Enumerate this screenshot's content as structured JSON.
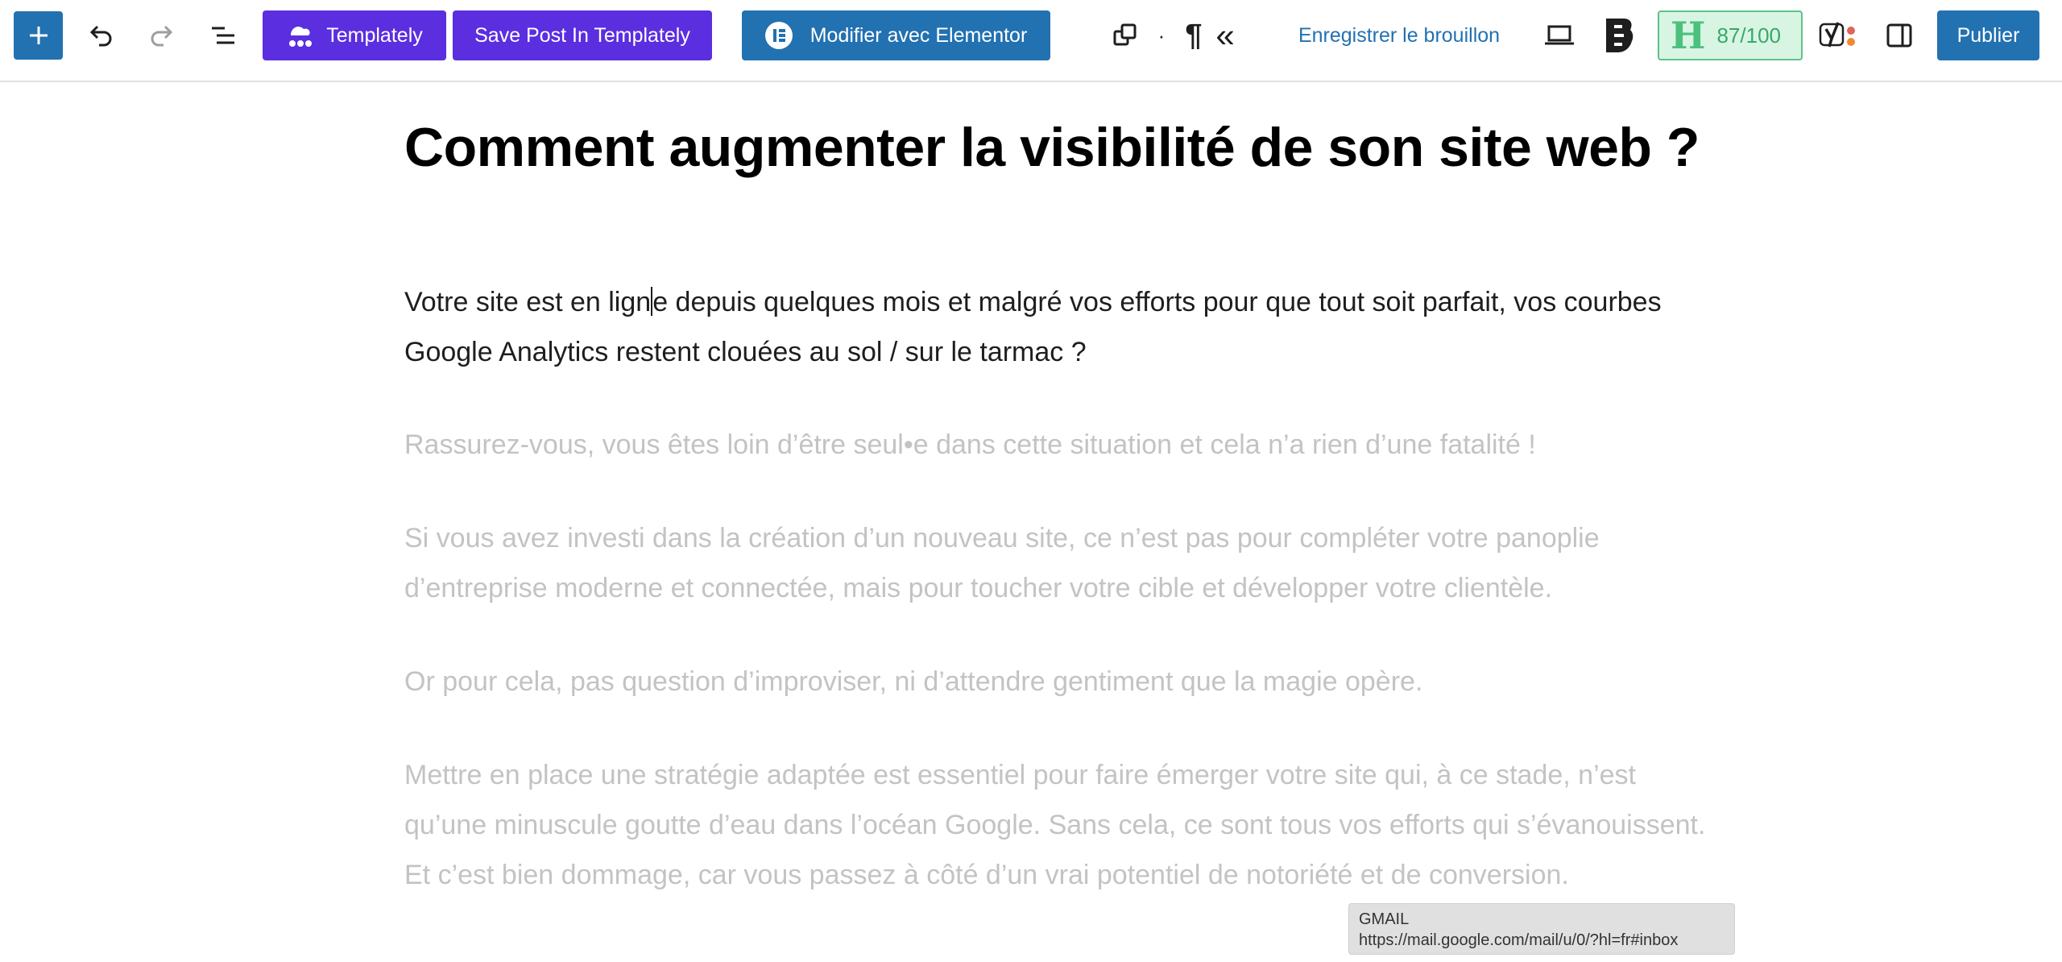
{
  "toolbar": {
    "add_block_icon": "plus-icon",
    "undo_icon": "undo-icon",
    "redo_icon": "redo-icon",
    "list_view_icon": "list-view-icon",
    "templately_label": "Templately",
    "save_post_label": "Save Post In Templately",
    "elementor_label": "Modifier avec Elementor",
    "separator_dot": "·",
    "pilcrow": "¶",
    "chevrons": "«",
    "save_draft_label": "Enregistrer le brouillon",
    "preview_icon": "laptop-icon",
    "bold_b_icon": "b-logo-icon",
    "hscore": {
      "letter": "H",
      "score": "87/100"
    },
    "yoast_icon": "yoast-icon",
    "sidebar_icon": "sidebar-toggle-icon",
    "publish_label": "Publier"
  },
  "colors": {
    "wp_blue": "#2271b1",
    "templately_purple": "#5b2ee0",
    "hscore_green": "#38a86a",
    "dim_text": "#c3c3c3"
  },
  "post": {
    "title": "Comment augmenter la visibilité de son site web ?",
    "active_paragraph": {
      "before_caret": "Votre site est en lign",
      "after_caret": "e depuis quelques mois et malgré vos efforts pour que tout soit parfait, vos courbes Google Analytics restent clouées au sol / sur le tarmac ?"
    },
    "paragraphs": [
      "Rassurez-vous, vous êtes loin d’être seul•e dans cette situation et cela n’a rien d’une fatalité !",
      "Si vous avez investi dans la création d’un nouveau site, ce n’est pas pour compléter votre panoplie d’entreprise moderne et connectée, mais pour toucher votre cible et développer votre clientèle.",
      "Or pour cela, pas question d’improviser, ni d’attendre gentiment que la magie opère.",
      "Mettre en place une stratégie adaptée est essentiel pour faire émerger votre site qui, à ce stade, n’est qu’une minuscule goutte d’eau dans l’océan Google. Sans cela, ce sont tous vos efforts qui s’évanouissent. Et c’est bien dommage, car vous passez à côté d’un vrai potentiel de notoriété et de conversion."
    ]
  },
  "tooltip": {
    "title": "GMAIL",
    "url": "https://mail.google.com/mail/u/0/?hl=fr#inbox"
  }
}
